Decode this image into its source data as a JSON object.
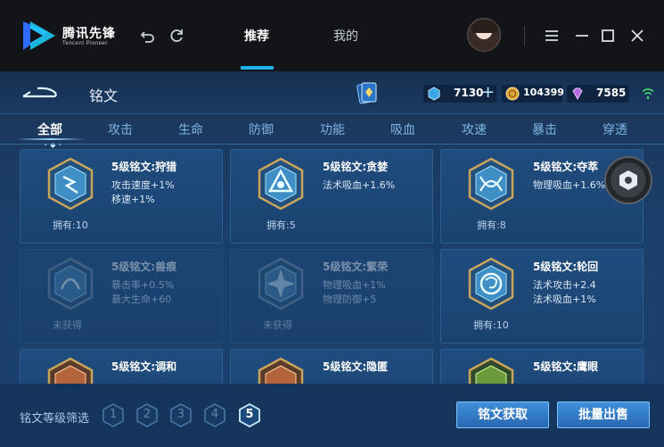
{
  "app": {
    "logo_text": "腾讯先锋",
    "logo_sub": "Tencent Pioneer",
    "nav_tabs": [
      {
        "label": "推荐",
        "active": true
      },
      {
        "label": "我的",
        "active": false
      }
    ],
    "accent_color": "#1fb5e8"
  },
  "game": {
    "page_title": "铭文",
    "resources": [
      {
        "icon": "blue-crystal-icon",
        "value": "7130"
      },
      {
        "icon": "gold-coin-icon",
        "value": "104399"
      },
      {
        "icon": "purple-diamond-icon",
        "value": "7585"
      }
    ],
    "categories": [
      {
        "label": "全部",
        "active": true
      },
      {
        "label": "攻击"
      },
      {
        "label": "生命"
      },
      {
        "label": "防御"
      },
      {
        "label": "功能"
      },
      {
        "label": "吸血"
      },
      {
        "label": "攻速"
      },
      {
        "label": "暴击"
      },
      {
        "label": "穿透"
      }
    ],
    "cards": [
      {
        "name": "5级铭文:狩猎",
        "attrs": [
          "攻击速度+1%",
          "移速+1%"
        ],
        "owned": "拥有:10",
        "gem": "blue",
        "dim": false
      },
      {
        "name": "5级铭文:贪婪",
        "attrs": [
          "法术吸血+1.6%"
        ],
        "owned": "拥有:5",
        "gem": "blue",
        "dim": false
      },
      {
        "name": "5级铭文:夺萃",
        "attrs": [
          "物理吸血+1.6%"
        ],
        "owned": "拥有:8",
        "gem": "blue",
        "dim": false
      },
      {
        "name": "5级铭文:兽痕",
        "attrs": [
          "暴击率+0.5%",
          "最大生命+60"
        ],
        "owned": "未获得",
        "gem": "blue",
        "dim": true
      },
      {
        "name": "5级铭文:繁荣",
        "attrs": [
          "物理吸血+1%",
          "物理防御+5"
        ],
        "owned": "未获得",
        "gem": "blue",
        "dim": true
      },
      {
        "name": "5级铭文:轮回",
        "attrs": [
          "法术攻击+2.4",
          "法术吸血+1%"
        ],
        "owned": "拥有:10",
        "gem": "blue",
        "dim": false
      }
    ],
    "cut_cards": [
      {
        "name": "5级铭文:调和",
        "gem": "red"
      },
      {
        "name": "5级铭文:隐匿",
        "gem": "red"
      },
      {
        "name": "5级铭文:鹰眼",
        "gem": "green"
      }
    ],
    "filter": {
      "label": "铭文等级筛选",
      "levels": [
        "1",
        "2",
        "3",
        "4",
        "5"
      ],
      "active_level": "5"
    },
    "buttons": {
      "obtain": "铭文获取",
      "bulk_sell": "批量出售"
    }
  }
}
